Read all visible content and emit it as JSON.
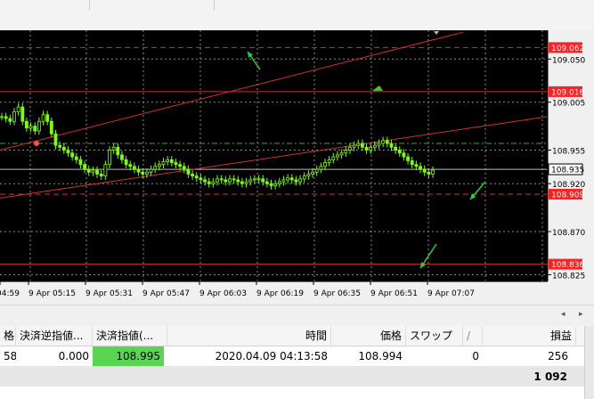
{
  "chart_data": {
    "type": "candlestick",
    "symbol_price_axis": {
      "ticks": [
        "109.050",
        "109.005",
        "108.955",
        "108.920",
        "108.870",
        "108.825"
      ],
      "tick_values": [
        109.05,
        109.005,
        108.955,
        108.92,
        108.87,
        108.825
      ],
      "ylim": [
        108.818,
        109.08
      ]
    },
    "time_axis": {
      "ticks": [
        "04:59",
        "9 Apr 05:15",
        "9 Apr 05:31",
        "9 Apr 05:47",
        "9 Apr 06:03",
        "9 Apr 06:19",
        "9 Apr 06:35",
        "9 Apr 06:51",
        "9 Apr 07:07"
      ]
    },
    "price_labels": [
      {
        "text": "109.062",
        "value": 109.062,
        "color": "#ff2020"
      },
      {
        "text": "109.016",
        "value": 109.016,
        "color": "#ff2020"
      },
      {
        "text": "108.935",
        "value": 108.935,
        "color": "#ffffff"
      },
      {
        "text": "108.909",
        "value": 108.909,
        "color": "#ff2020"
      },
      {
        "text": "108.836",
        "value": 108.836,
        "color": "#ff2020"
      }
    ],
    "horizontal_lines": [
      {
        "value": 109.062,
        "style": "dashed",
        "color": "#d03030"
      },
      {
        "value": 109.016,
        "style": "solid",
        "color": "#d03030"
      },
      {
        "value": 108.962,
        "style": "dashdot",
        "color": "#33aa33"
      },
      {
        "value": 108.935,
        "style": "solid",
        "color": "#bbbbbb"
      },
      {
        "value": 108.909,
        "style": "dashed",
        "color": "#d03030"
      },
      {
        "value": 108.836,
        "style": "solid",
        "color": "#d03030"
      }
    ],
    "close_series": [
      108.99,
      108.988,
      108.985,
      108.995,
      109.0,
      108.985,
      108.978,
      108.98,
      108.975,
      108.985,
      108.992,
      108.985,
      108.972,
      108.96,
      108.958,
      108.955,
      108.952,
      108.948,
      108.945,
      108.94,
      108.935,
      108.932,
      108.934,
      108.93,
      108.928,
      108.94,
      108.955,
      108.958,
      108.95,
      108.945,
      108.94,
      108.938,
      108.935,
      108.932,
      108.93,
      108.932,
      108.935,
      108.938,
      108.94,
      108.943,
      108.945,
      108.942,
      108.94,
      108.938,
      108.935,
      108.93,
      108.928,
      108.926,
      108.924,
      108.922,
      108.92,
      108.922,
      108.925,
      108.924,
      108.922,
      108.925,
      108.924,
      108.922,
      108.92,
      108.922,
      108.924,
      108.925,
      108.925,
      108.922,
      108.92,
      108.918,
      108.92,
      108.922,
      108.924,
      108.926,
      108.924,
      108.922,
      108.925,
      108.928,
      108.93,
      108.932,
      108.935,
      108.938,
      108.942,
      108.945,
      108.948,
      108.95,
      108.952,
      108.955,
      108.958,
      108.96,
      108.962,
      108.958,
      108.955,
      108.958,
      108.96,
      108.962,
      108.965,
      108.962,
      108.958,
      108.955,
      108.952,
      108.948,
      108.944,
      108.94,
      108.938,
      108.935,
      108.932,
      108.93,
      108.934
    ],
    "bullish_color": "#7fff00",
    "bearish_color": "#7fff00",
    "background": "#000000",
    "grid": true,
    "gridline_style": "dotted",
    "x_steps": 106
  },
  "table": {
    "headers": [
      "格",
      "決済逆指値...",
      "決済指値(...",
      "時間",
      "価格",
      "スワップ",
      "/",
      "損益"
    ],
    "row": [
      "58",
      "0.000",
      "108.995",
      "2020.04.09 04:13:58",
      "108.994",
      "0",
      "256"
    ],
    "total": "1 092"
  },
  "colors": {
    "take_profit_cell": "#5ad552"
  }
}
